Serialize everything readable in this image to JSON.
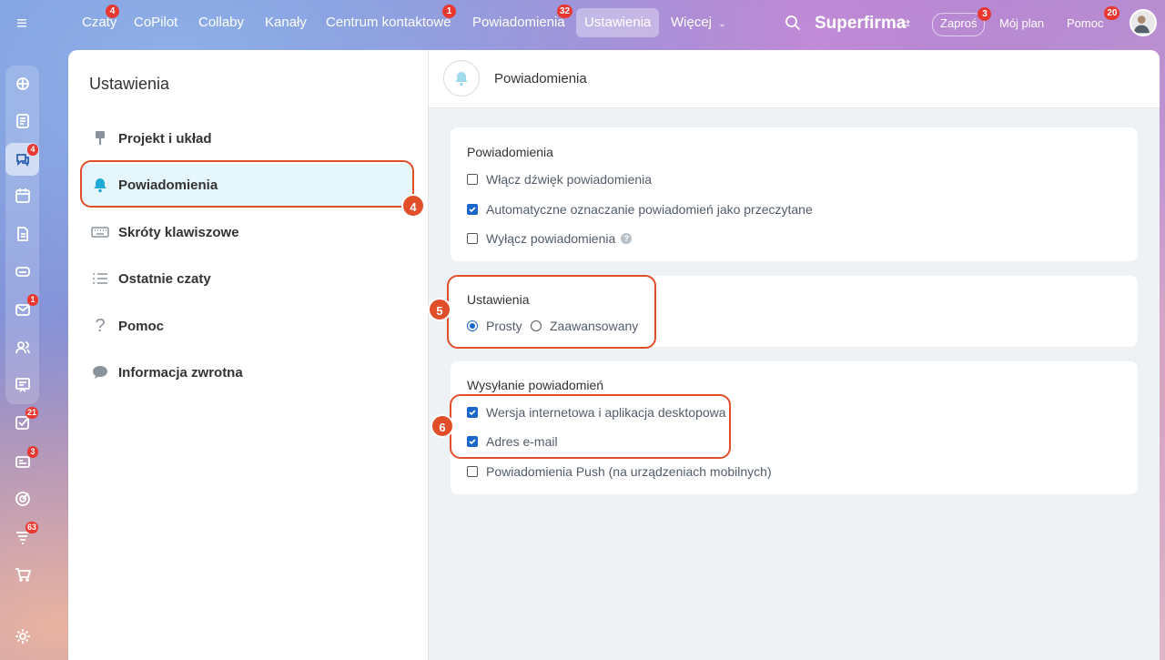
{
  "topbar": {
    "tabs": [
      {
        "label": "Czaty",
        "badge": "4"
      },
      {
        "label": "CoPilot",
        "badge": ""
      },
      {
        "label": "Collaby",
        "badge": ""
      },
      {
        "label": "Kanały",
        "badge": ""
      },
      {
        "label": "Centrum kontaktowe",
        "badge": "1"
      },
      {
        "label": "Powiadomienia",
        "badge": "32"
      },
      {
        "label": "Ustawienia",
        "badge": ""
      },
      {
        "label": "Więcej",
        "badge": ""
      }
    ],
    "brand": "Superfirma",
    "invite": {
      "label": "Zaproś",
      "badge": "3"
    },
    "plan": "Mój plan",
    "help": {
      "label": "Pomoc",
      "badge": "20"
    }
  },
  "rail": {
    "badges": {
      "chats": "4",
      "mail": "1",
      "tasks": "21",
      "feed": "3",
      "crm": "63"
    }
  },
  "settings": {
    "title": "Ustawienia",
    "nav": [
      {
        "label": "Projekt i układ"
      },
      {
        "label": "Powiadomienia"
      },
      {
        "label": "Skróty klawiszowe"
      },
      {
        "label": "Ostatnie czaty"
      },
      {
        "label": "Pomoc"
      },
      {
        "label": "Informacja zwrotna"
      }
    ]
  },
  "content": {
    "title": "Powiadomienia",
    "section1": {
      "title": "Powiadomienia",
      "options": [
        {
          "label": "Włącz dźwięk powiadomienia",
          "checked": false
        },
        {
          "label": "Automatyczne oznaczanie powiadomień jako przeczytane",
          "checked": true
        },
        {
          "label": "Wyłącz powiadomienia",
          "checked": false
        }
      ]
    },
    "section2": {
      "title": "Ustawienia",
      "radio_simple": "Prosty",
      "radio_advanced": "Zaawansowany",
      "selected": "Prosty"
    },
    "section3": {
      "title": "Wysyłanie powiadomień",
      "options": [
        {
          "label": "Wersja internetowa i aplikacja desktopowa",
          "checked": true
        },
        {
          "label": "Adres e-mail",
          "checked": true
        },
        {
          "label": "Powiadomienia Push (na urządzeniach mobilnych)",
          "checked": false
        }
      ]
    }
  },
  "annotations": {
    "n4": "4",
    "n5": "5",
    "n6": "6"
  },
  "colors": {
    "accent": "#1a66c9",
    "highlight": "#e04e2a",
    "badge": "#e8382f",
    "active_nav": "#e5f7fc"
  }
}
